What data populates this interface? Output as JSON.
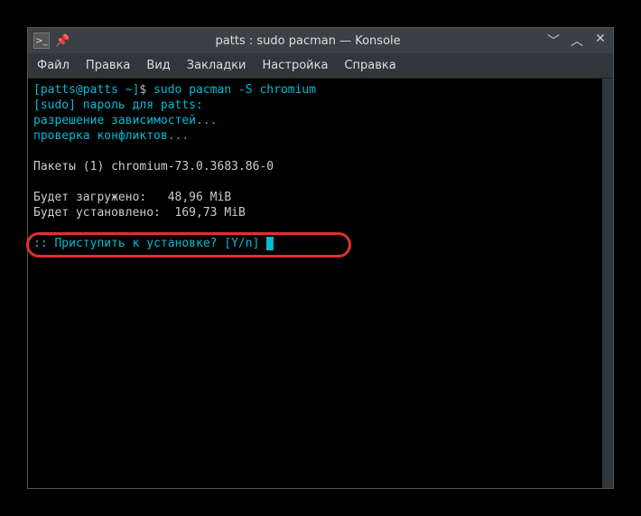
{
  "titlebar": {
    "icon_glyph": ">_",
    "title": "patts : sudo pacman — Konsole"
  },
  "menubar": {
    "items": [
      {
        "label": "Файл"
      },
      {
        "label": "Правка"
      },
      {
        "label": "Вид"
      },
      {
        "label": "Закладки"
      },
      {
        "label": "Настройка"
      },
      {
        "label": "Справка"
      }
    ]
  },
  "terminal": {
    "prompt_open": "[",
    "prompt_user": "patts@patts",
    "prompt_path": " ~",
    "prompt_close": "]",
    "prompt_dollar": "$ ",
    "command": "sudo pacman -S chromium",
    "sudo_password": "[sudo] пароль для patts:",
    "resolve_deps": "разрешение зависимостей...",
    "check_conflicts": "проверка конфликтов...",
    "packages_line": "Пакеты (1) chromium-73.0.3683.86-0",
    "download_size": "Будет загружено:   48,96 MiB",
    "install_size": "Будет установлено:  169,73 MiB",
    "confirm_prompt": ":: Приступить к установке? [Y/n] "
  }
}
